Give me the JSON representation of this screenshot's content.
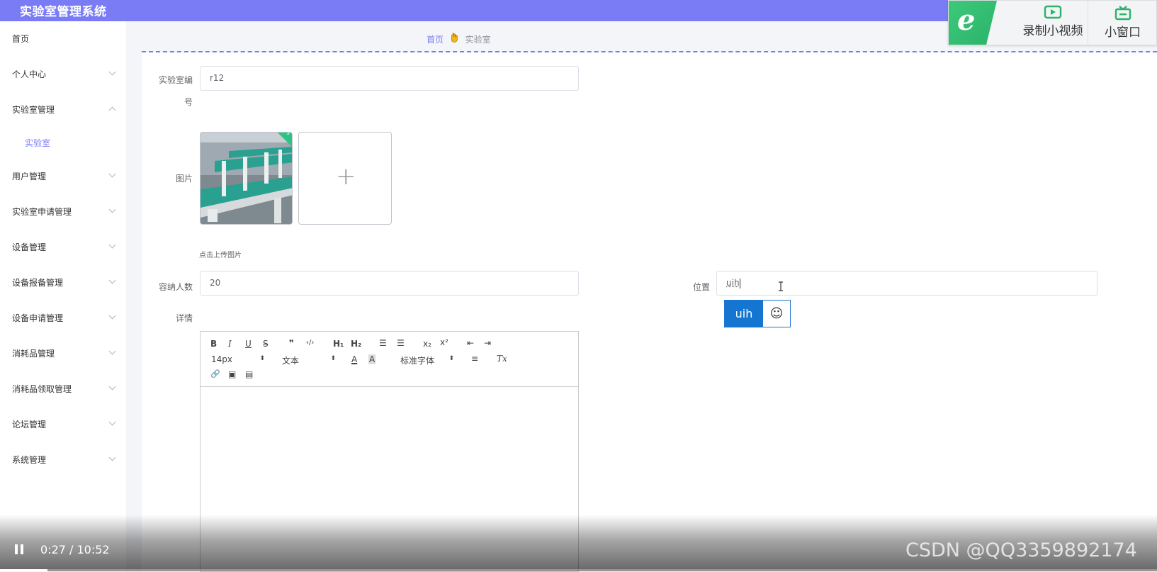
{
  "app": {
    "title": "实验室管理系统"
  },
  "overlay": {
    "record_label": "录制小视频",
    "mini_label": "小窗口",
    "logo_glyph": "e"
  },
  "sidebar": {
    "items": [
      {
        "label": "首页",
        "has_chevron": false
      },
      {
        "label": "个人中心",
        "has_chevron": true
      },
      {
        "label": "实验室管理",
        "has_chevron": true,
        "expanded": true
      },
      {
        "label": "实验室",
        "sub": true
      },
      {
        "label": "用户管理",
        "has_chevron": true
      },
      {
        "label": "实验室申请管理",
        "has_chevron": true
      },
      {
        "label": "设备管理",
        "has_chevron": true
      },
      {
        "label": "设备报备管理",
        "has_chevron": true
      },
      {
        "label": "设备申请管理",
        "has_chevron": true
      },
      {
        "label": "消耗品管理",
        "has_chevron": true
      },
      {
        "label": "消耗品领取管理",
        "has_chevron": true
      },
      {
        "label": "论坛管理",
        "has_chevron": true
      },
      {
        "label": "系统管理",
        "has_chevron": true
      }
    ]
  },
  "breadcrumb": {
    "home": "首页",
    "separator_icon": "hand-icon",
    "current": "实验室"
  },
  "form": {
    "lab_number_label_line1": "实验室编",
    "lab_number_label_line2": "号",
    "lab_number_value": "r12",
    "image_label": "图片",
    "upload_tip": "点击上传图片",
    "upload_plus": "+",
    "capacity_label": "容纳人数",
    "capacity_value": "20",
    "location_label": "位置",
    "location_value": "uih",
    "details_label": "详情"
  },
  "ime": {
    "candidate": "uih",
    "emoji_glyph": "☺"
  },
  "editor": {
    "font_size": "14px",
    "text_type": "文本",
    "font_family": "标准字体",
    "buttons": {
      "bold": "B",
      "italic": "I",
      "underline": "U",
      "strike": "S",
      "quote": "❞",
      "code": "‹/›",
      "h1": "H₁",
      "h2": "H₂",
      "ordered": "☰",
      "bullet": "☰",
      "sub": "x₂",
      "sup": "x²",
      "outdent": "⇤",
      "indent": "⇥",
      "color": "A",
      "background": "A",
      "align": "≡",
      "clean": "Tx",
      "link": "🔗",
      "image": "▣",
      "video": "▤"
    },
    "select_arrow": "⬍"
  },
  "video": {
    "current_time": "0:27",
    "duration": "10:52",
    "time_display": "0:27 / 10:52",
    "progress_fraction": 0.041,
    "watermark": "CSDN @QQ3359892174"
  }
}
